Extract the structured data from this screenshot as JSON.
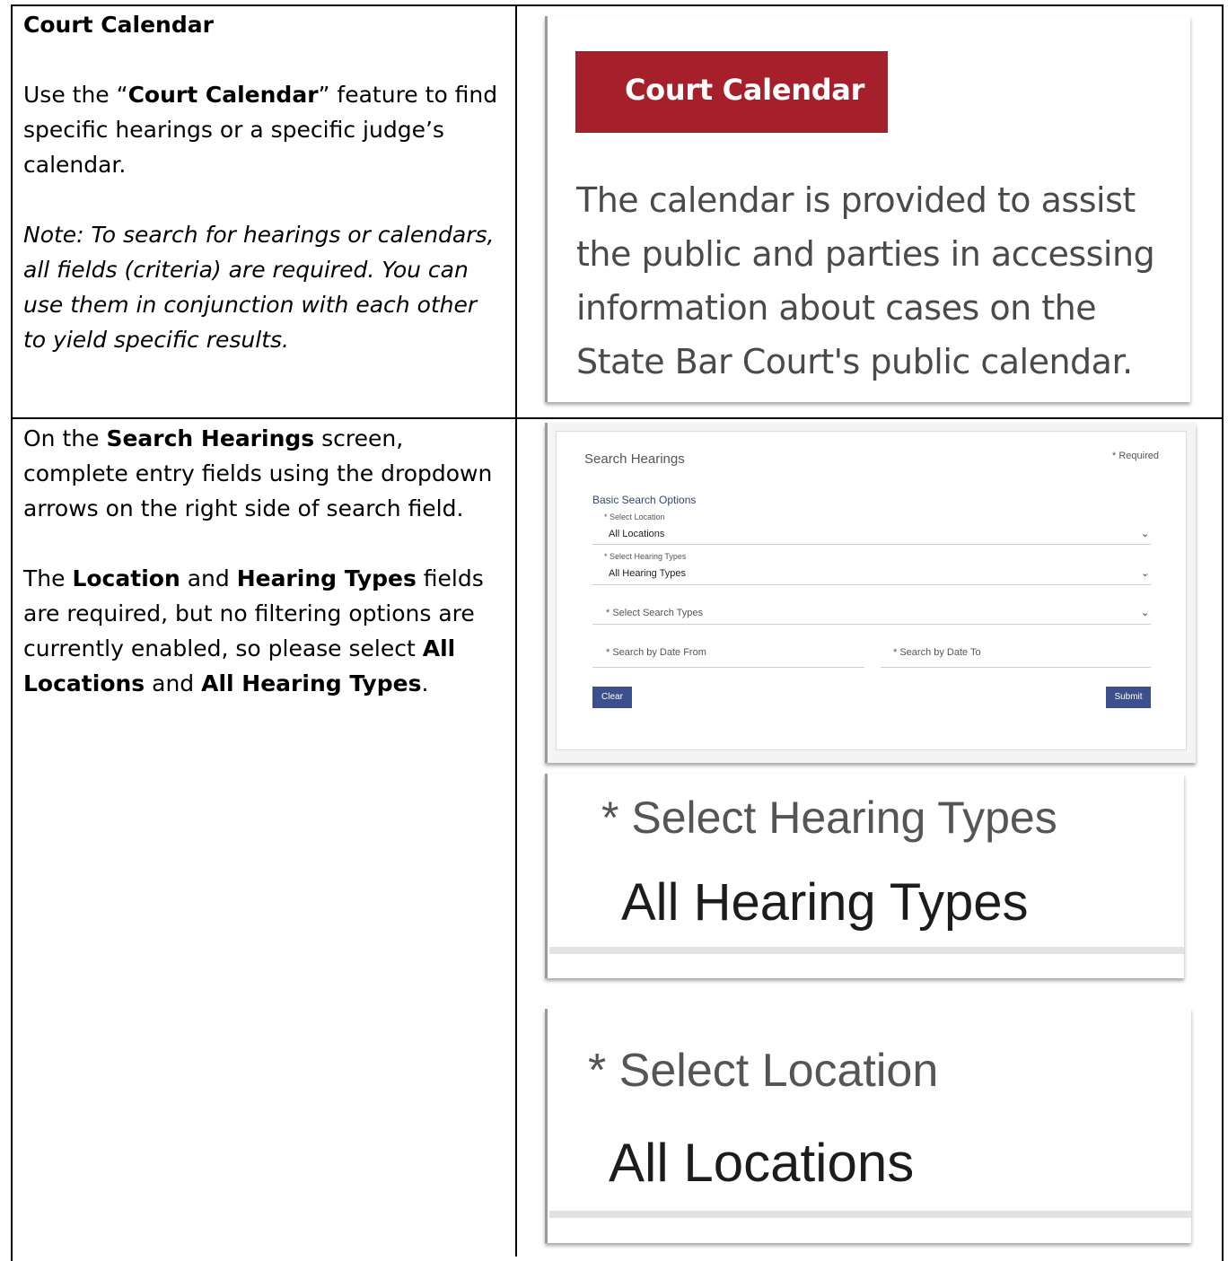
{
  "row1": {
    "heading": "Court Calendar",
    "intro_pre": "Use the “",
    "intro_bold": "Court Calendar",
    "intro_post": "” feature to find specific hearings or a specific judge’s calendar.",
    "note": "Note: To search for hearings or calendars, all fields (criteria) are required. You can use them in conjunction with each other to yield specific results.",
    "screenshot": {
      "banner": "Court Calendar",
      "banner_color": "#a5202a",
      "description": "The calendar is provided to assist the public and parties in accessing information about cases on the State Bar Court's public calendar."
    }
  },
  "row2": {
    "p1_pre": "On the ",
    "p1_bold": "Search Hearings",
    "p1_post": " screen, complete entry fields using the dropdown arrows on the right side of search field.",
    "p2_pre": "The ",
    "p2_b1": "Location",
    "p2_mid1": " and ",
    "p2_b2": "Hearing Types",
    "p2_mid2": " fields are required, but no filtering options are currently enabled, so please select ",
    "p2_b3": "All Locations",
    "p2_mid3": " and ",
    "p2_b4": "All Hearing Types",
    "p2_end": ".",
    "form": {
      "title": "Search Hearings",
      "required_note": "* Required",
      "section": "Basic Search Options",
      "location_label": "* Select Location",
      "location_value": "All Locations",
      "hearing_label": "* Select Hearing Types",
      "hearing_value": "All Hearing Types",
      "search_types_placeholder": "* Select Search Types",
      "date_from_placeholder": "* Search by Date From",
      "date_to_placeholder": "* Search by Date To",
      "clear_label": "Clear",
      "submit_label": "Submit",
      "button_color": "#3c4f8e"
    },
    "zoom_hearing": {
      "label": "* Select Hearing Types",
      "value": "All Hearing Types"
    },
    "zoom_location": {
      "label": "* Select Location",
      "value": "All Locations"
    }
  }
}
